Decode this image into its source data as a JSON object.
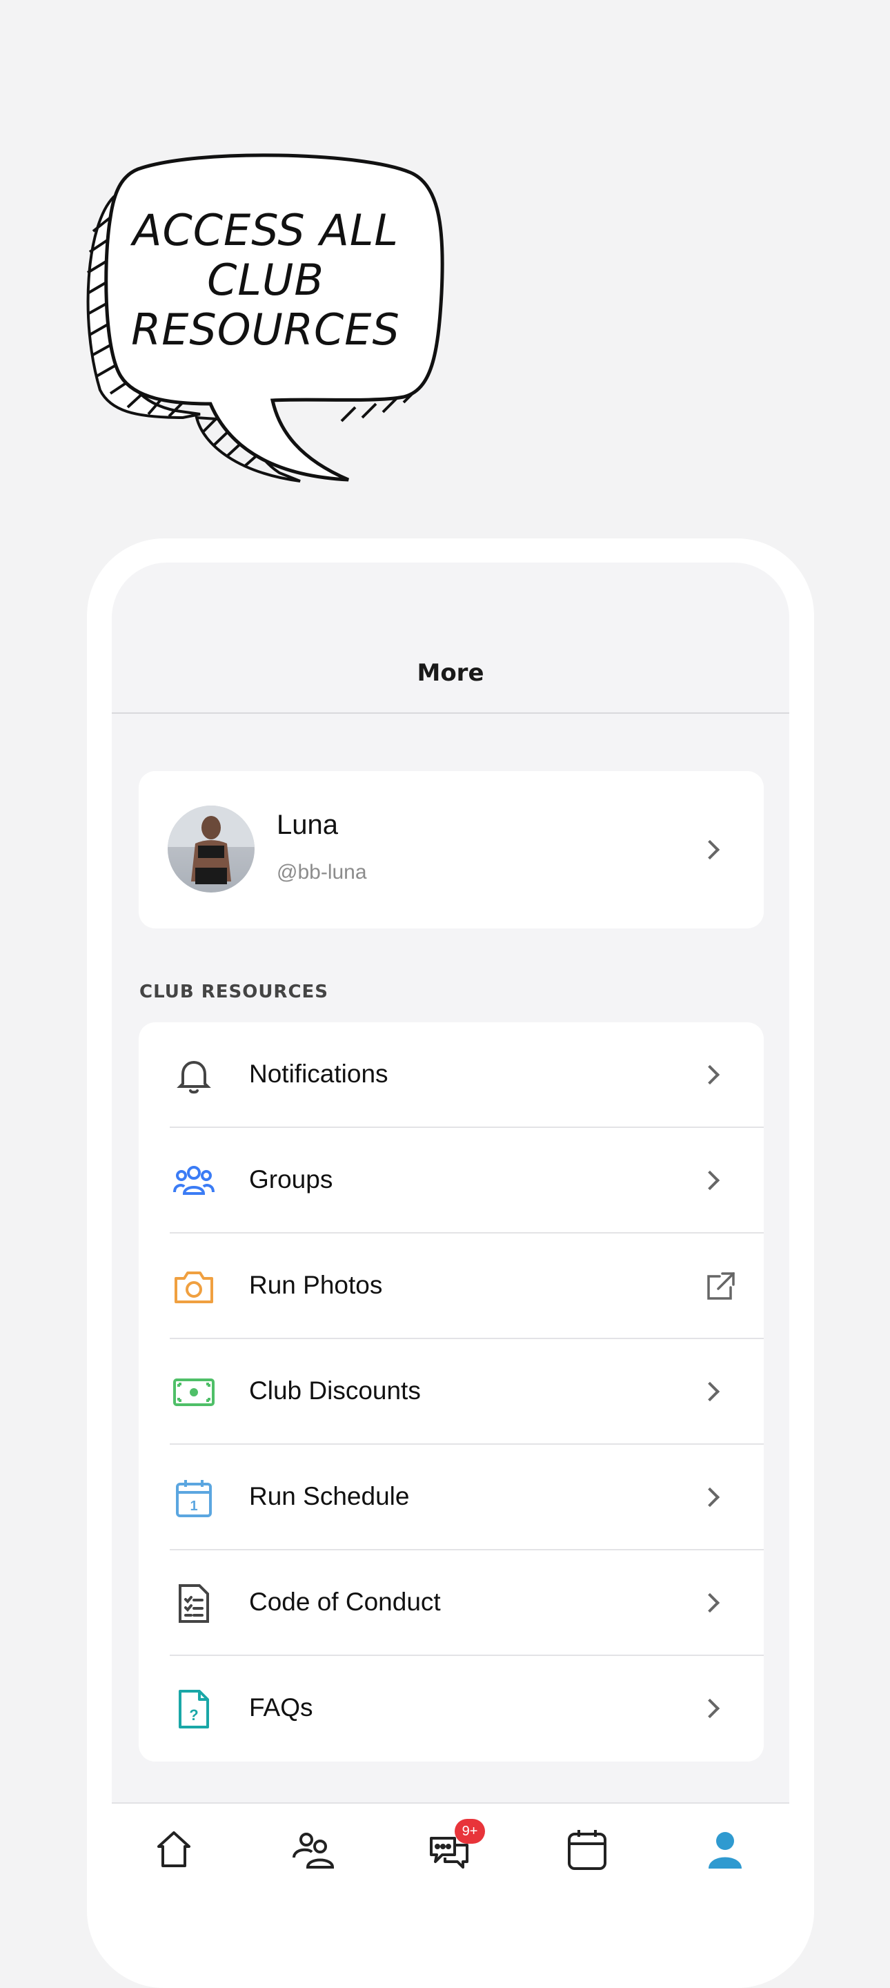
{
  "promo": {
    "headline_lines": [
      "ACCESS ALL",
      "CLUB",
      "RESOURCES"
    ]
  },
  "screen": {
    "title": "More",
    "profile": {
      "name": "Luna",
      "handle": "@bb-luna"
    },
    "section_label": "CLUB RESOURCES",
    "items": [
      {
        "label": "Notifications",
        "icon": "bell-icon",
        "trailing": "chevron",
        "color": "#444444"
      },
      {
        "label": "Groups",
        "icon": "users-icon",
        "trailing": "chevron",
        "color": "#3b7cf5"
      },
      {
        "label": "Run Photos",
        "icon": "camera-icon",
        "trailing": "external-link",
        "color": "#f0a040"
      },
      {
        "label": "Club Discounts",
        "icon": "cash-icon",
        "trailing": "chevron",
        "color": "#4fbf68"
      },
      {
        "label": "Run Schedule",
        "icon": "calendar-icon",
        "trailing": "chevron",
        "color": "#5ba6e0"
      },
      {
        "label": "Code of Conduct",
        "icon": "checklist-icon",
        "trailing": "chevron",
        "color": "#444444"
      },
      {
        "label": "FAQs",
        "icon": "faq-icon",
        "trailing": "chevron",
        "color": "#1aa7a7"
      }
    ],
    "tabbar": {
      "tabs": [
        "home-tab",
        "friends-tab",
        "messages-tab",
        "calendar-tab",
        "profile-tab"
      ],
      "messages_badge": "9+",
      "active_color": "#2f9ad0"
    }
  }
}
